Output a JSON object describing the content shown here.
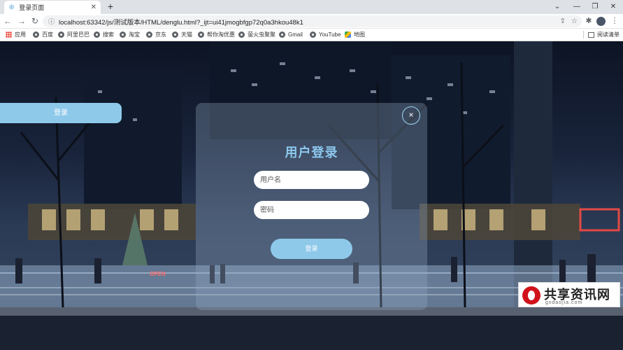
{
  "browser": {
    "tab_title": "登录页面",
    "url": "localhost:63342/js/测试版本/HTML/denglu.html?_ijt=ui41jmogbfgp72q0a3hkou48k1"
  },
  "bookmarks": [
    "应用",
    "百度",
    "阿里巴巴",
    "搜索",
    "淘宝",
    "京东",
    "天猫",
    "帮你淘优惠",
    "萤火虫聚聚",
    "Gmail",
    "YouTube",
    "地图"
  ],
  "reading_list": "阅读清单",
  "page": {
    "side_login": "登录",
    "close_glyph": "×",
    "title": "用户登录",
    "username_placeholder": "用户名",
    "password_placeholder": "密码",
    "submit": "登录"
  },
  "background_sign": "OPEN",
  "watermark": {
    "cn": "共享资讯网",
    "en": "gxdaojia.com"
  }
}
